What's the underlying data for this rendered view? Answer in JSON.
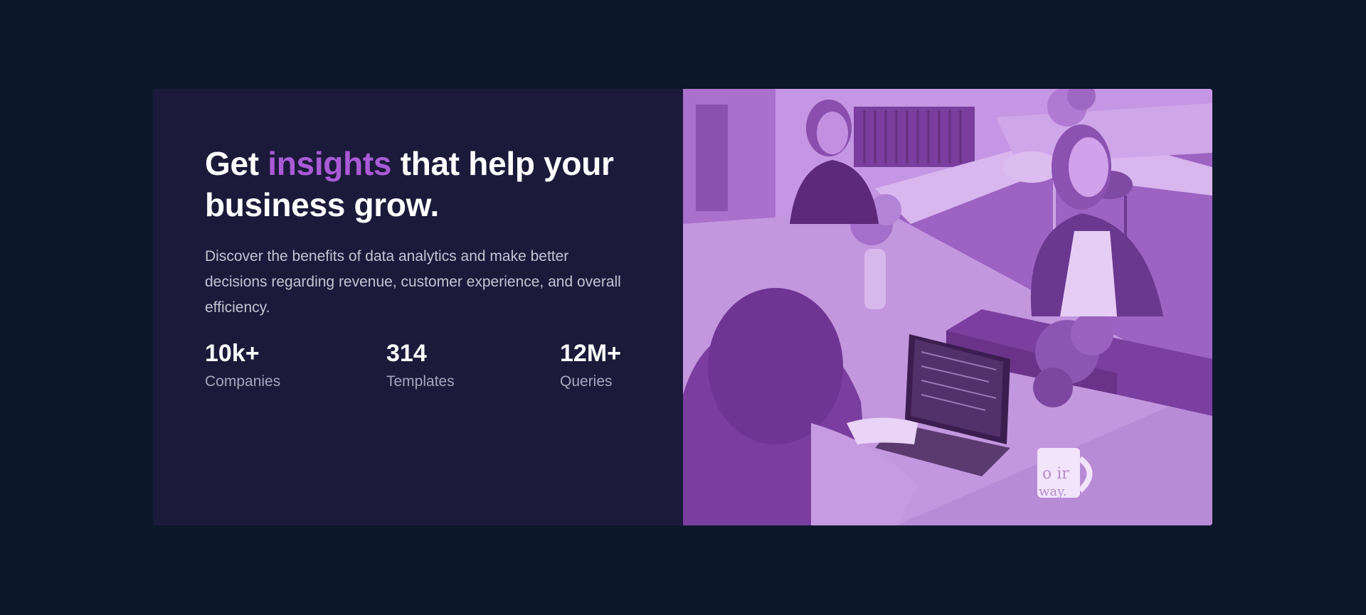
{
  "hero": {
    "headline_prefix": "Get ",
    "headline_accent": "insights",
    "headline_suffix": " that help your business grow.",
    "description": "Discover the benefits of data analytics and make better decisions regarding revenue, customer experience, and overall efficiency.",
    "accent_color": "#a95bd6"
  },
  "stats": [
    {
      "value": "10k+",
      "label": "Companies"
    },
    {
      "value": "314",
      "label": "Templates"
    },
    {
      "value": "12M+",
      "label": "Queries"
    }
  ],
  "image": {
    "mug_text_line1": "o ir",
    "mug_text_line2": "way."
  },
  "colors": {
    "page_background": "#0d182a",
    "card_background": "#1c1a3a",
    "photo_tint": "#9a5cbe"
  }
}
